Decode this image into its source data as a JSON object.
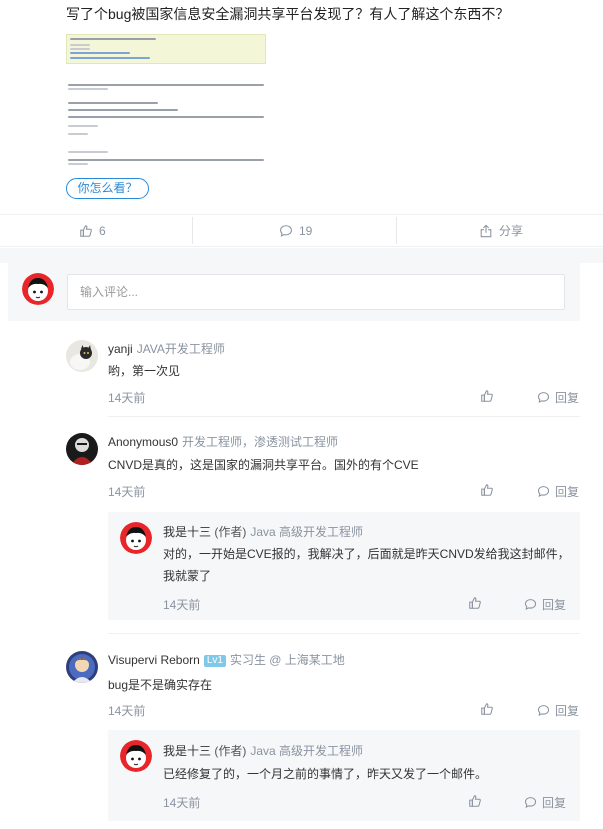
{
  "post": {
    "title": "写了个bug被国家信息安全漏洞共享平台发现了？有人了解这个东西不？",
    "ask_button": "你怎么看？"
  },
  "actions": {
    "like_count": "6",
    "comment_count": "19",
    "share_label": "分享"
  },
  "comment_input": {
    "placeholder": "输入评论..."
  },
  "comments": [
    {
      "name": "yanji",
      "role": "JAVA开发工程师",
      "text": "哟，第一次见",
      "time": "14天前",
      "reply_label": "回复"
    },
    {
      "name": "Anonymous0",
      "role": "开发工程师，渗透测试工程师",
      "text": "CNVD是真的，这是国家的漏洞共享平台。国外的有个CVE",
      "time": "14天前",
      "reply_label": "回复",
      "replies": [
        {
          "name": "我是十三",
          "author_tag": "(作者)",
          "role": "Java 高级开发工程师",
          "text_line1": "对的，一开始是CVE报的，我解决了，后面就是昨天CNVD发给我这封邮件，",
          "text_line2": "我就蒙了",
          "time": "14天前",
          "reply_label": "回复"
        }
      ]
    },
    {
      "name": "Visupervi Reborn",
      "badge": "Lv1",
      "role": "实习生 @ 上海某工地",
      "text": "bug是不是确实存在",
      "time": "14天前",
      "reply_label": "回复",
      "replies": [
        {
          "name": "我是十三",
          "author_tag": "(作者)",
          "role": "Java 高级开发工程师",
          "text_line1": "已经修复了的，一个月之前的事情了，昨天又发了一个邮件。",
          "time": "14天前",
          "reply_label": "回复"
        }
      ]
    }
  ],
  "colors": {
    "accent": "#2a8ad8",
    "muted": "#8a93a0",
    "panel": "#f6f7f9",
    "avatar_red": "#e8262a"
  },
  "icons": {
    "like": "thumbs-up-icon",
    "comment": "speech-bubble-icon",
    "share": "share-icon",
    "reply": "speech-bubble-icon"
  }
}
